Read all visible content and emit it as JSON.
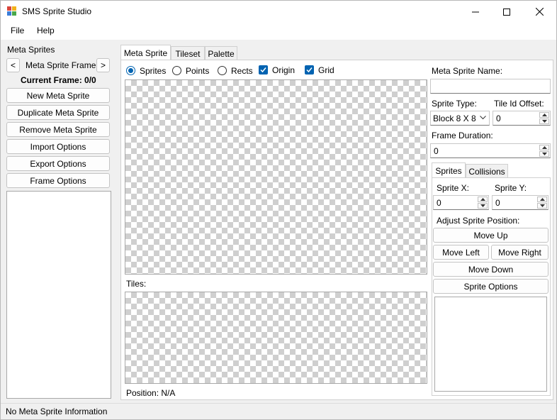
{
  "window": {
    "title": "SMS Sprite Studio"
  },
  "menu": {
    "file": "File",
    "help": "Help"
  },
  "left": {
    "group_title": "Meta Sprites",
    "prev_label": "<",
    "next_label": ">",
    "frame_label": "Meta Sprite Frame",
    "current_frame": "Current Frame: 0/0",
    "buttons": {
      "new": "New Meta Sprite",
      "duplicate": "Duplicate Meta Sprite",
      "remove": "Remove Meta Sprite",
      "import": "Import Options",
      "export": "Export Options",
      "frame": "Frame Options"
    }
  },
  "tabs": {
    "meta_sprite": "Meta Sprite",
    "tileset": "Tileset",
    "palette": "Palette"
  },
  "editor": {
    "radios": {
      "sprites": "Sprites",
      "points": "Points",
      "rects": "Rects"
    },
    "checks": {
      "origin": "Origin",
      "grid": "Grid"
    },
    "tiles_label": "Tiles:",
    "position": "Position: N/A"
  },
  "props": {
    "name_label": "Meta Sprite Name:",
    "name_value": "",
    "sprite_type_label": "Sprite Type:",
    "sprite_type_value": "Block 8 X 8",
    "tile_offset_label": "Tile Id Offset:",
    "tile_offset_value": "0",
    "frame_duration_label": "Frame Duration:",
    "frame_duration_value": "0",
    "subtabs": {
      "sprites": "Sprites",
      "collisions": "Collisions"
    },
    "sprite_x_label": "Sprite X:",
    "sprite_x_value": "0",
    "sprite_y_label": "Sprite Y:",
    "sprite_y_value": "0",
    "adjust_label": "Adjust Sprite Position:",
    "move_up": "Move Up",
    "move_left": "Move Left",
    "move_right": "Move Right",
    "move_down": "Move Down",
    "sprite_options": "Sprite Options"
  },
  "status": {
    "text": "No Meta Sprite Information"
  },
  "colors": {
    "accent": "#0063b1",
    "checker": "#cfcfcf"
  }
}
